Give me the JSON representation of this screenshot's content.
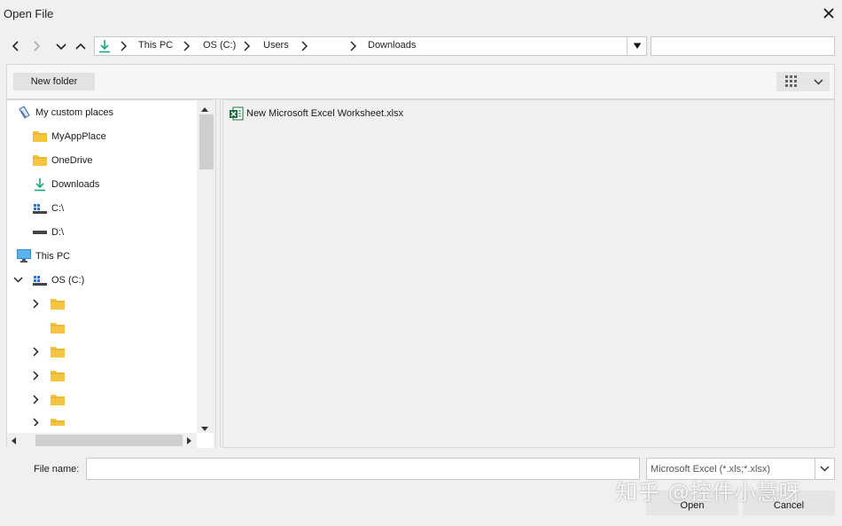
{
  "window": {
    "title": "Open File"
  },
  "address_bar": {
    "location_icon": "download-arrow-icon",
    "crumbs": [
      "This PC",
      "OS (C:)",
      "Users",
      "",
      "Downloads"
    ]
  },
  "search": {
    "value": "",
    "placeholder": ""
  },
  "toolbar": {
    "new_folder_label": "New folder",
    "view_icon": "grid-view-icon"
  },
  "tree": {
    "items": [
      {
        "label": "My custom places",
        "icon": "custom-places-icon"
      },
      {
        "label": "MyAppPlace",
        "icon": "folder-icon"
      },
      {
        "label": "OneDrive",
        "icon": "folder-icon"
      },
      {
        "label": "Downloads",
        "icon": "download-arrow-icon"
      },
      {
        "label": "C:\\",
        "icon": "drive-icon"
      },
      {
        "label": "D:\\",
        "icon": "drive-icon"
      },
      {
        "label": "This PC",
        "icon": "monitor-icon"
      },
      {
        "label": "OS (C:)",
        "icon": "drive-icon"
      },
      {
        "label": "",
        "icon": "folder-icon"
      },
      {
        "label": "",
        "icon": "folder-icon"
      },
      {
        "label": "",
        "icon": "folder-icon"
      },
      {
        "label": "",
        "icon": "folder-icon"
      },
      {
        "label": "",
        "icon": "folder-icon"
      },
      {
        "label": "",
        "icon": "folder-icon"
      }
    ]
  },
  "files": [
    {
      "name": "New Microsoft Excel Worksheet.xlsx",
      "icon": "excel-file-icon"
    }
  ],
  "footer": {
    "file_name_label": "File name:",
    "file_name_value": "",
    "filter_value": "Microsoft Excel (*.xls;*.xlsx)",
    "open_label": "Open",
    "cancel_label": "Cancel"
  },
  "watermark": "知乎 @控件小慧呀",
  "colors": {
    "folder": "#f5c542",
    "download_arrow": "#1aa57c",
    "excel_green": "#1d6f42"
  }
}
